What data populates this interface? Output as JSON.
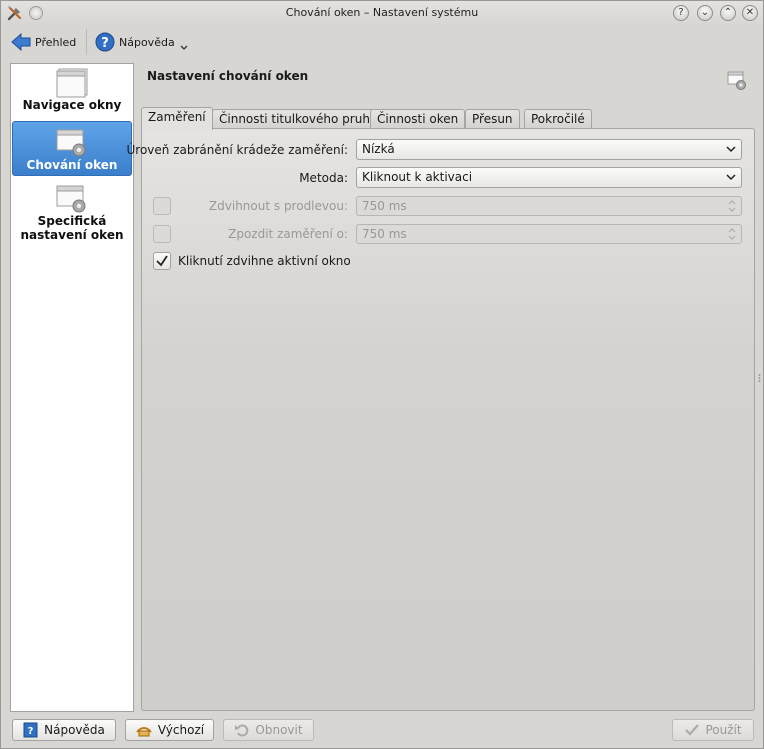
{
  "window": {
    "title": "Chování oken – Nastavení systému"
  },
  "toolbar": {
    "overview_label": "Přehled",
    "help_label": "Nápověda"
  },
  "sidebar": {
    "items": [
      {
        "label": "Navigace okny"
      },
      {
        "label": "Chování oken"
      },
      {
        "label": "Specifická nastavení oken"
      }
    ]
  },
  "main": {
    "page_title": "Nastavení chování oken",
    "tabs": [
      {
        "label": "Zaměření"
      },
      {
        "label": "Činnosti titulkového pruhu"
      },
      {
        "label": "Činnosti oken"
      },
      {
        "label": "Přesun"
      },
      {
        "label": "Pokročilé"
      }
    ],
    "focus": {
      "stealing_label": "Úroveň zabránění krádeže zaměření:",
      "stealing_value": "Nízká",
      "method_label": "Metoda:",
      "method_value": "Kliknout k aktivaci",
      "raise_delay_label": "Zdvihnout s prodlevou:",
      "raise_delay_value": "750 ms",
      "focus_delay_label": "Zpozdit zaměření o:",
      "focus_delay_value": "750 ms",
      "click_raise_label": "Kliknutí zdvihne aktivní okno"
    }
  },
  "buttons": {
    "help": "Nápověda",
    "defaults": "Výchozí",
    "reset": "Obnovit",
    "apply": "Použít"
  }
}
